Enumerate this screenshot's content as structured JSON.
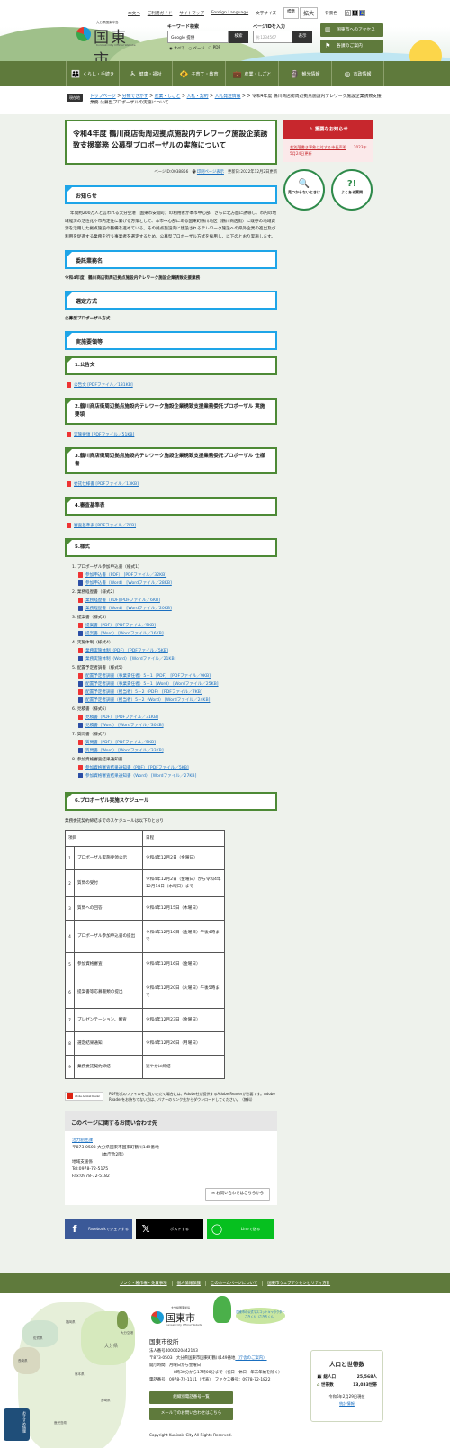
{
  "header": {
    "utility": {
      "text_only": "本文へ",
      "guide": "ご利用ガイド",
      "sitemap": "サイトマップ",
      "foreign": "Foreign Language",
      "font_size_label": "文字サイズ",
      "font_std": "標準",
      "font_large": "拡大",
      "bg_label": "背景色",
      "bg_white": "白",
      "bg_black": "黒",
      "bg_blue": "青"
    },
    "logo": {
      "prefecture": "大分県国東半島",
      "name": "国東市",
      "english": "Kunisaki City Official Website"
    },
    "search": {
      "label": "キーワード検索",
      "placeholder": "Google 提供",
      "button": "検索",
      "scopes": [
        "すべて",
        "ページ",
        "PDF"
      ]
    },
    "page_id": {
      "label": "ページIDを入力",
      "placeholder": "例:1234567",
      "button": "表示"
    },
    "buttons": {
      "access": "国東市へのアクセス",
      "departments": "各課のご案内"
    }
  },
  "nav": [
    {
      "label": "くらし・手続き",
      "icon": "family-icon"
    },
    {
      "label": "健康・福祉",
      "icon": "wheelchair-icon"
    },
    {
      "label": "子育て・教育",
      "icon": "child-icon"
    },
    {
      "label": "産業・しごと",
      "icon": "briefcase-icon"
    },
    {
      "label": "観光情報",
      "icon": "statue-icon"
    },
    {
      "label": "市政情報",
      "icon": "city-icon"
    }
  ],
  "breadcrumb": {
    "here": "現在地",
    "items": [
      "トップページ",
      "分類でさがす",
      "産業・しごと",
      "入札・契約",
      "入札発注情報"
    ],
    "current": "令和4年度 鶴川商店街周辺拠点施設内テレワーク施設企業誘致支援業務 公募型プロポーザルの実施について"
  },
  "article": {
    "title": "令和4年度 鶴川商店街周辺拠点施設内テレワーク施設企業誘致支援業務 公募型プロポーザルの実施について",
    "page_id": "ページID:0038856",
    "print": "印刷ページ表示",
    "updated": "更新日:2022年12月2日更新",
    "notice_heading": "お知らせ",
    "notice_body": "年間約200万人と言われる大分空港（国東市安岐町）の利用者が本市中心部、さらに北方面に誘導し、市内の地域経済の活性化や市内定住に繋げる方策として、本市中心部にある国東町鶴川地区（鶴川商店街）に既存の地域資源を活用した拠点施設の整備を進めている。その拠点施設内に建設されるテレワーク施設への県外企業の進出及び利用を促進する業務を行う事業者を選定するため、公募型プロポーザル方式を採用し、以下のとおり実施します。",
    "h_work": "委託業務名",
    "work_name": "令和4年度　鶴川商店街周辺拠点施設内テレワーク施設企業誘致支援業務",
    "h_method": "選定方式",
    "method": "公募型プロポーザル方式",
    "h_docs": "実施要領等",
    "s1": "1.公告文",
    "s1_file": "公告文 [PDFファイル／131KB]",
    "s2": "2.鶴川商店街周辺拠点施設内テレワーク施設企業誘致支援業務委託プロポーザル 実施要領",
    "s2_file": "実施要領 [PDFファイル／51KB]",
    "s3": "3.鶴川商店街周辺拠点施設内テレワーク施設企業誘致支援業務委託プロポーザル 仕様書",
    "s3_file": "委託仕様書 [PDFファイル／13KB]",
    "s4": "4.審査基準表",
    "s4_file": "審査基準表 [PDFファイル／7KB]",
    "s5": "5.様式",
    "forms": [
      {
        "label": "1. プロポーザル参加申込書（様式1）",
        "files": [
          {
            "type": "pdf",
            "text": "参加申込書（PDF） [PDFファイル／32KB]"
          },
          {
            "type": "word",
            "text": "参加申込書（Word） [Wordファイル／28KB]"
          }
        ]
      },
      {
        "label": "2. 業務経歴書（様式2）",
        "files": [
          {
            "type": "pdf",
            "text": "業務経歴書（PDF)[PDFファイル／6KB]"
          },
          {
            "type": "word",
            "text": "業務経歴書（Word） [Wordファイル／20KB]"
          }
        ]
      },
      {
        "label": "3. 提案書（様式3）",
        "files": [
          {
            "type": "pdf",
            "text": "提案書（PDF） [PDFファイル／5KB]"
          },
          {
            "type": "word",
            "text": "提案書（Word） [Wordファイル／16KB]"
          }
        ]
      },
      {
        "label": "4. 実施体制（様式4）",
        "files": [
          {
            "type": "pdf",
            "text": "業務実施体制（PDF） [PDFファイル／5KB]"
          },
          {
            "type": "word",
            "text": "業務実施体制（Word） [Wordファイル／21KB]"
          }
        ]
      },
      {
        "label": "5. 配置予定者調書（様式5）",
        "files": [
          {
            "type": "pdf",
            "text": "配置予定者調書（事業責任者）5－1（PDF） [PDFファイル／9KB]"
          },
          {
            "type": "word",
            "text": "配置予定者調書（事業責任者）5－1（Word） [Wordファイル／25KB]"
          },
          {
            "type": "pdf",
            "text": "配置予定者調書（担当者）5－2（PDF） [PDFファイル／7KB]"
          },
          {
            "type": "word",
            "text": "配置予定者調書（担当者）5－2（Word） [Wordファイル／24KB]"
          }
        ]
      },
      {
        "label": "6. 見積書（様式6）",
        "files": [
          {
            "type": "pdf",
            "text": "見積書（PDF） [PDFファイル／31KB]"
          },
          {
            "type": "word",
            "text": "見積書（Word） [Wordファイル／30KB]"
          }
        ]
      },
      {
        "label": "7. 質問書（様式7）",
        "files": [
          {
            "type": "pdf",
            "text": "質問書（PDF） [PDFファイル／5KB]"
          },
          {
            "type": "word",
            "text": "質問書（Word） [Wordファイル／33KB]"
          }
        ]
      },
      {
        "label": "8. 参加資格審査結果通知書",
        "files": [
          {
            "type": "pdf",
            "text": "参加資格審査結果通知書（PDF） [PDFファイル／5KB]"
          },
          {
            "type": "word",
            "text": "参加資格審査結果通知書（Word） [Wordファイル／27KB]"
          }
        ]
      }
    ],
    "s6": "6.プロポーザル実施スケジュール",
    "s6_intro": "業務委託契約締結までのスケジュールは以下のとおり",
    "schedule": {
      "headers": [
        "項目",
        "日程"
      ],
      "rows": [
        [
          "1",
          "プロポーザル実施要領公示",
          "令和4年12月2日（金曜日）"
        ],
        [
          "2",
          "質問の受付",
          "令和4年12月2日（金曜日）から令和4年12月14日（水曜日）まで"
        ],
        [
          "3",
          "質問への回答",
          "令和4年12月15日（木曜日）"
        ],
        [
          "4",
          "プロポーザル参加申込書の提出",
          "令和4年12月16日（金曜日）午後4時まで"
        ],
        [
          "5",
          "参加資格審査",
          "令和4年12月16日（金曜日）"
        ],
        [
          "6",
          "提案書等応募書類の提出",
          "令和4年12月20日（火曜日）午後5時まで"
        ],
        [
          "7",
          "プレゼンテーション、審査",
          "令和4年12月23日（金曜日）"
        ],
        [
          "8",
          "選定結果通知",
          "令和4年12月26日（月曜日）"
        ],
        [
          "9",
          "業務委託契約締結",
          "速やかに締結"
        ]
      ]
    },
    "adobe": {
      "banner": "Adobe Acrobat Reader",
      "text": "PDF形式のファイルをご覧いただく場合には、Adobe社が提供するAdobe Readerが必要です。Adobe Readerをお持ちでない方は、バナーのリンク先からダウンロードしてください。（無料）"
    },
    "contact": {
      "heading": "このページに関するお問い合わせ先",
      "dept": "活力創生課",
      "address": "〒873-0503 大分県国東市国東町鶴川149番地",
      "building": "（本庁舎2階）",
      "section": "地域支援係",
      "tel": "Tel:0978-72-5175",
      "fax": "Fax:0978-72-5182",
      "mail_button": "お問い合わせはこちらから"
    },
    "share": {
      "facebook": "Facebookでシェアする",
      "x": "ポストする",
      "line": "Lineで送る"
    }
  },
  "sidebar": {
    "notice_title": "重要なお知らせ",
    "notice_link": "差別落書き事象に対する市長声明",
    "notice_date": "2023年5月24日更新",
    "cant_find": "見つからないときは",
    "faq": "よくある質問"
  },
  "footer": {
    "links": [
      "リンク・著作権・免責事項",
      "個人情報保護",
      "このホームページについて",
      "国東市ウェブアクセシビリティ方針"
    ],
    "map_labels": [
      "福岡県",
      "佐賀県",
      "長崎県",
      "熊本県",
      "大分県",
      "宮崎県",
      "鹿児島県",
      "大分空港"
    ],
    "logo": {
      "prefecture": "大分県国東半島",
      "name": "国東市",
      "english": "Kunisaki City Official Website"
    },
    "mascot": "国東市の公式マスコットキャラクター さきくん（さきちくん）",
    "office": "国東市役所",
    "corp_no": "法人番号4000020442143",
    "address": "〒873-0503　大分県国東市国東町鶴川149番地",
    "address_link": "（庁舎のご案内）",
    "hours_label": "開庁時間：月曜日から金曜日",
    "hours": "8時30分から17時00分まで（祝日・休日・年末年始を除く）",
    "phone": "電話番号：0978-72-1111（代表）　ファクス番号：0978-72-1822",
    "btn_phone": "組織別電話番号一覧",
    "btn_mail": "メールでのお問い合わせはこちら",
    "copyright": "Copyright Kunisaki City All Rights Reserved.",
    "population": {
      "title": "人口と世帯数",
      "pop_label": "総人口",
      "pop": "25,568人",
      "hh_label": "世帯数",
      "hh": "13,033世帯",
      "as_of": "令和6年2月29日現在",
      "stats_link": "統計情報"
    },
    "osusume": "おすすめ情報"
  },
  "colors": {
    "green": "#5f7a3c",
    "blue": "#1ea5e8",
    "red": "#c7272d",
    "bg": "#eef2ec"
  }
}
